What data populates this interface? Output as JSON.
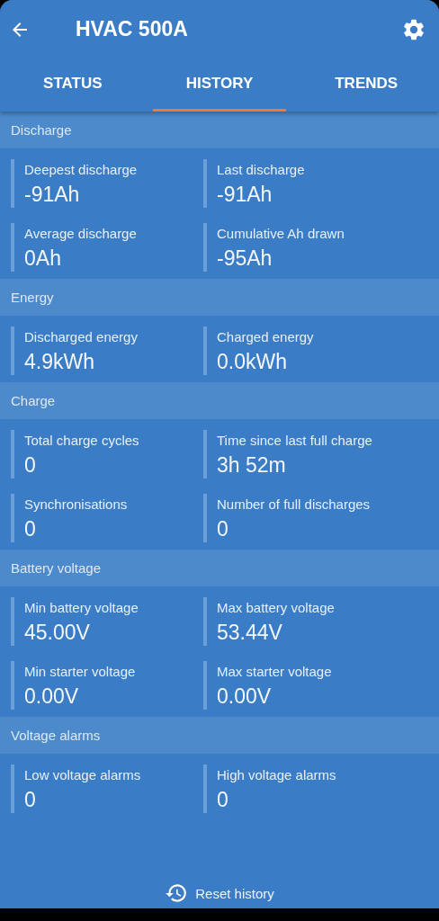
{
  "app_bar": {
    "title": "HVAC 500A"
  },
  "tabs": [
    {
      "label": "STATUS",
      "selected": false
    },
    {
      "label": "HISTORY",
      "selected": true
    },
    {
      "label": "TRENDS",
      "selected": false
    }
  ],
  "sections": [
    {
      "title": "Discharge",
      "items": [
        {
          "label": "Deepest discharge",
          "value": "-91Ah"
        },
        {
          "label": "Last discharge",
          "value": "-91Ah"
        },
        {
          "label": "Average discharge",
          "value": "0Ah"
        },
        {
          "label": "Cumulative Ah drawn",
          "value": "-95Ah"
        }
      ]
    },
    {
      "title": "Energy",
      "items": [
        {
          "label": "Discharged energy",
          "value": "4.9kWh"
        },
        {
          "label": "Charged energy",
          "value": "0.0kWh"
        }
      ]
    },
    {
      "title": "Charge",
      "items": [
        {
          "label": "Total charge cycles",
          "value": "0"
        },
        {
          "label": "Time since last full charge",
          "value": "3h 52m"
        },
        {
          "label": "Synchronisations",
          "value": "0"
        },
        {
          "label": "Number of full discharges",
          "value": "0"
        }
      ]
    },
    {
      "title": "Battery voltage",
      "items": [
        {
          "label": "Min battery voltage",
          "value": "45.00V"
        },
        {
          "label": "Max battery voltage",
          "value": "53.44V"
        },
        {
          "label": "Min starter voltage",
          "value": "0.00V"
        },
        {
          "label": "Max starter voltage",
          "value": "0.00V"
        }
      ]
    },
    {
      "title": "Voltage alarms",
      "items": [
        {
          "label": "Low voltage alarms",
          "value": "0"
        },
        {
          "label": "High voltage alarms",
          "value": "0"
        }
      ]
    }
  ],
  "reset_button": {
    "label": "Reset history"
  }
}
